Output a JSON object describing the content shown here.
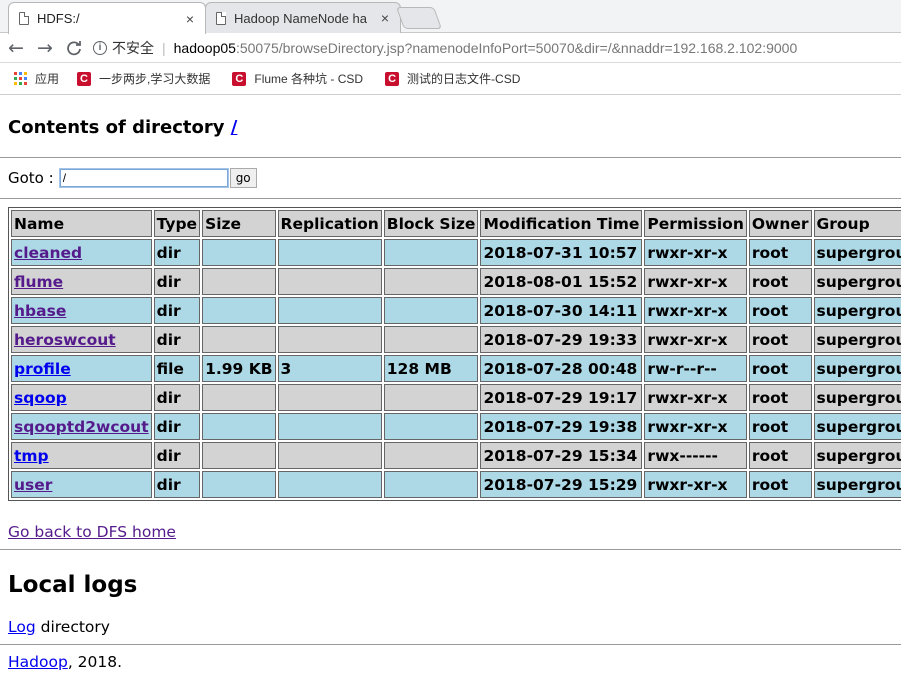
{
  "browser": {
    "tabs": [
      {
        "title": "HDFS:/",
        "active": true
      },
      {
        "title": "Hadoop NameNode ha",
        "active": false
      }
    ],
    "close_glyph": "×",
    "nav": {
      "back": "←",
      "forward": "→",
      "reload": "C"
    },
    "security_label": "不安全",
    "url_host": "hadoop05",
    "url_rest": ":50075/browseDirectory.jsp?namenodeInfoPort=50070&dir=/&nnaddr=192.168.2.102:9000",
    "bookmarks": [
      {
        "label": "应用",
        "icon": "apps-icon"
      },
      {
        "label": "一步两步,学习大数据",
        "icon": "csdn-icon"
      },
      {
        "label": "Flume 各种坑 - CSD",
        "icon": "csdn-icon"
      },
      {
        "label": "测试的日志文件-CSD",
        "icon": "csdn-icon"
      }
    ]
  },
  "page": {
    "heading": "Contents of directory",
    "heading_link": "/",
    "goto_label": "Goto :",
    "goto_value": "/",
    "goto_button": "go",
    "columns": [
      "Name",
      "Type",
      "Size",
      "Replication",
      "Block Size",
      "Modification Time",
      "Permission",
      "Owner",
      "Group"
    ],
    "rows": [
      {
        "name": "cleaned",
        "type": "dir",
        "size": "",
        "replication": "",
        "block_size": "",
        "mtime": "2018-07-31 10:57",
        "permission": "rwxr-xr-x",
        "owner": "root",
        "group": "supergroup"
      },
      {
        "name": "flume",
        "type": "dir",
        "size": "",
        "replication": "",
        "block_size": "",
        "mtime": "2018-08-01 15:52",
        "permission": "rwxr-xr-x",
        "owner": "root",
        "group": "supergroup"
      },
      {
        "name": "hbase",
        "type": "dir",
        "size": "",
        "replication": "",
        "block_size": "",
        "mtime": "2018-07-30 14:11",
        "permission": "rwxr-xr-x",
        "owner": "root",
        "group": "supergroup"
      },
      {
        "name": "heroswcout",
        "type": "dir",
        "size": "",
        "replication": "",
        "block_size": "",
        "mtime": "2018-07-29 19:33",
        "permission": "rwxr-xr-x",
        "owner": "root",
        "group": "supergroup"
      },
      {
        "name": "profile",
        "type": "file",
        "size": "1.99 KB",
        "replication": "3",
        "block_size": "128 MB",
        "mtime": "2018-07-28 00:48",
        "permission": "rw-r--r--",
        "owner": "root",
        "group": "supergroup"
      },
      {
        "name": "sqoop",
        "type": "dir",
        "size": "",
        "replication": "",
        "block_size": "",
        "mtime": "2018-07-29 19:17",
        "permission": "rwxr-xr-x",
        "owner": "root",
        "group": "supergroup"
      },
      {
        "name": "sqooptd2wcout",
        "type": "dir",
        "size": "",
        "replication": "",
        "block_size": "",
        "mtime": "2018-07-29 19:38",
        "permission": "rwxr-xr-x",
        "owner": "root",
        "group": "supergroup"
      },
      {
        "name": "tmp",
        "type": "dir",
        "size": "",
        "replication": "",
        "block_size": "",
        "mtime": "2018-07-29 15:34",
        "permission": "rwx------",
        "owner": "root",
        "group": "supergroup"
      },
      {
        "name": "user",
        "type": "dir",
        "size": "",
        "replication": "",
        "block_size": "",
        "mtime": "2018-07-29 15:29",
        "permission": "rwxr-xr-x",
        "owner": "root",
        "group": "supergroup"
      }
    ],
    "visited_links": [
      "cleaned",
      "flume",
      "hbase",
      "heroswcout",
      "sqooptd2wcout",
      "user"
    ],
    "back_link": "Go back to DFS home",
    "local_logs_heading": "Local logs",
    "log_link": "Log",
    "log_text": " directory",
    "footer_link": "Hadoop",
    "footer_text": ", 2018."
  },
  "colors": {
    "row_blue": "#add8e6",
    "row_grey": "#d3d3d3",
    "link": "#0000ee",
    "visited_link": "#551a8b",
    "csdn_red": "#c8102e"
  }
}
